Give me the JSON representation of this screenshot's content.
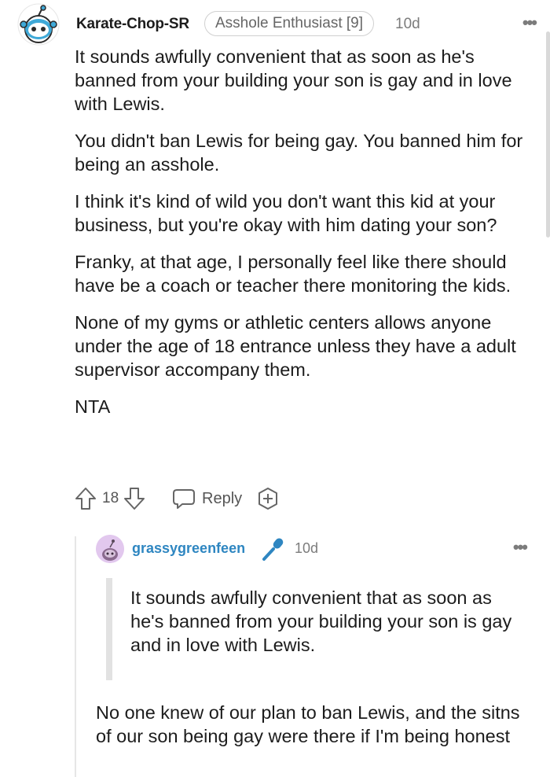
{
  "comment": {
    "username": "Karate-Chop-SR",
    "flair": "Asshole Enthusiast [9]",
    "time": "10d",
    "more": "•••",
    "paragraphs": [
      "It sounds awfully convenient that as soon as he's banned from your building your son is gay and in love with Lewis.",
      "You didn't ban Lewis for being gay. You banned him for being an asshole.",
      "I think it's kind of wild you don't want this kid at your business, but you're okay with him dating your son?",
      "Franky, at that age, I personally feel like there should have be a coach or teacher there monitoring the kids.",
      "None of my gyms or athletic centers allows anyone under the age of 18 entrance unless they have a adult supervisor accompany them.",
      "NTA"
    ],
    "score": "18",
    "reply_label": "Reply"
  },
  "reply": {
    "username": "grassygreenfeen",
    "time": "10d",
    "more": "•••",
    "quote": "It sounds awfully convenient that as soon as he's banned from your building your son is gay and in love with Lewis.",
    "text": "No one knew of our plan to ban Lewis, and the sitns of our son being gay were there if I'm being honest"
  },
  "colors": {
    "username_reply": "#2e86c1",
    "mic": "#2e86c1",
    "muted": "#7c7c7c"
  },
  "icons": [
    "snoo-avatar-icon",
    "more-options-icon",
    "upvote-icon",
    "downvote-icon",
    "reply-bubble-icon",
    "award-plus-icon",
    "snoo-reply-avatar-icon",
    "microphone-icon"
  ]
}
